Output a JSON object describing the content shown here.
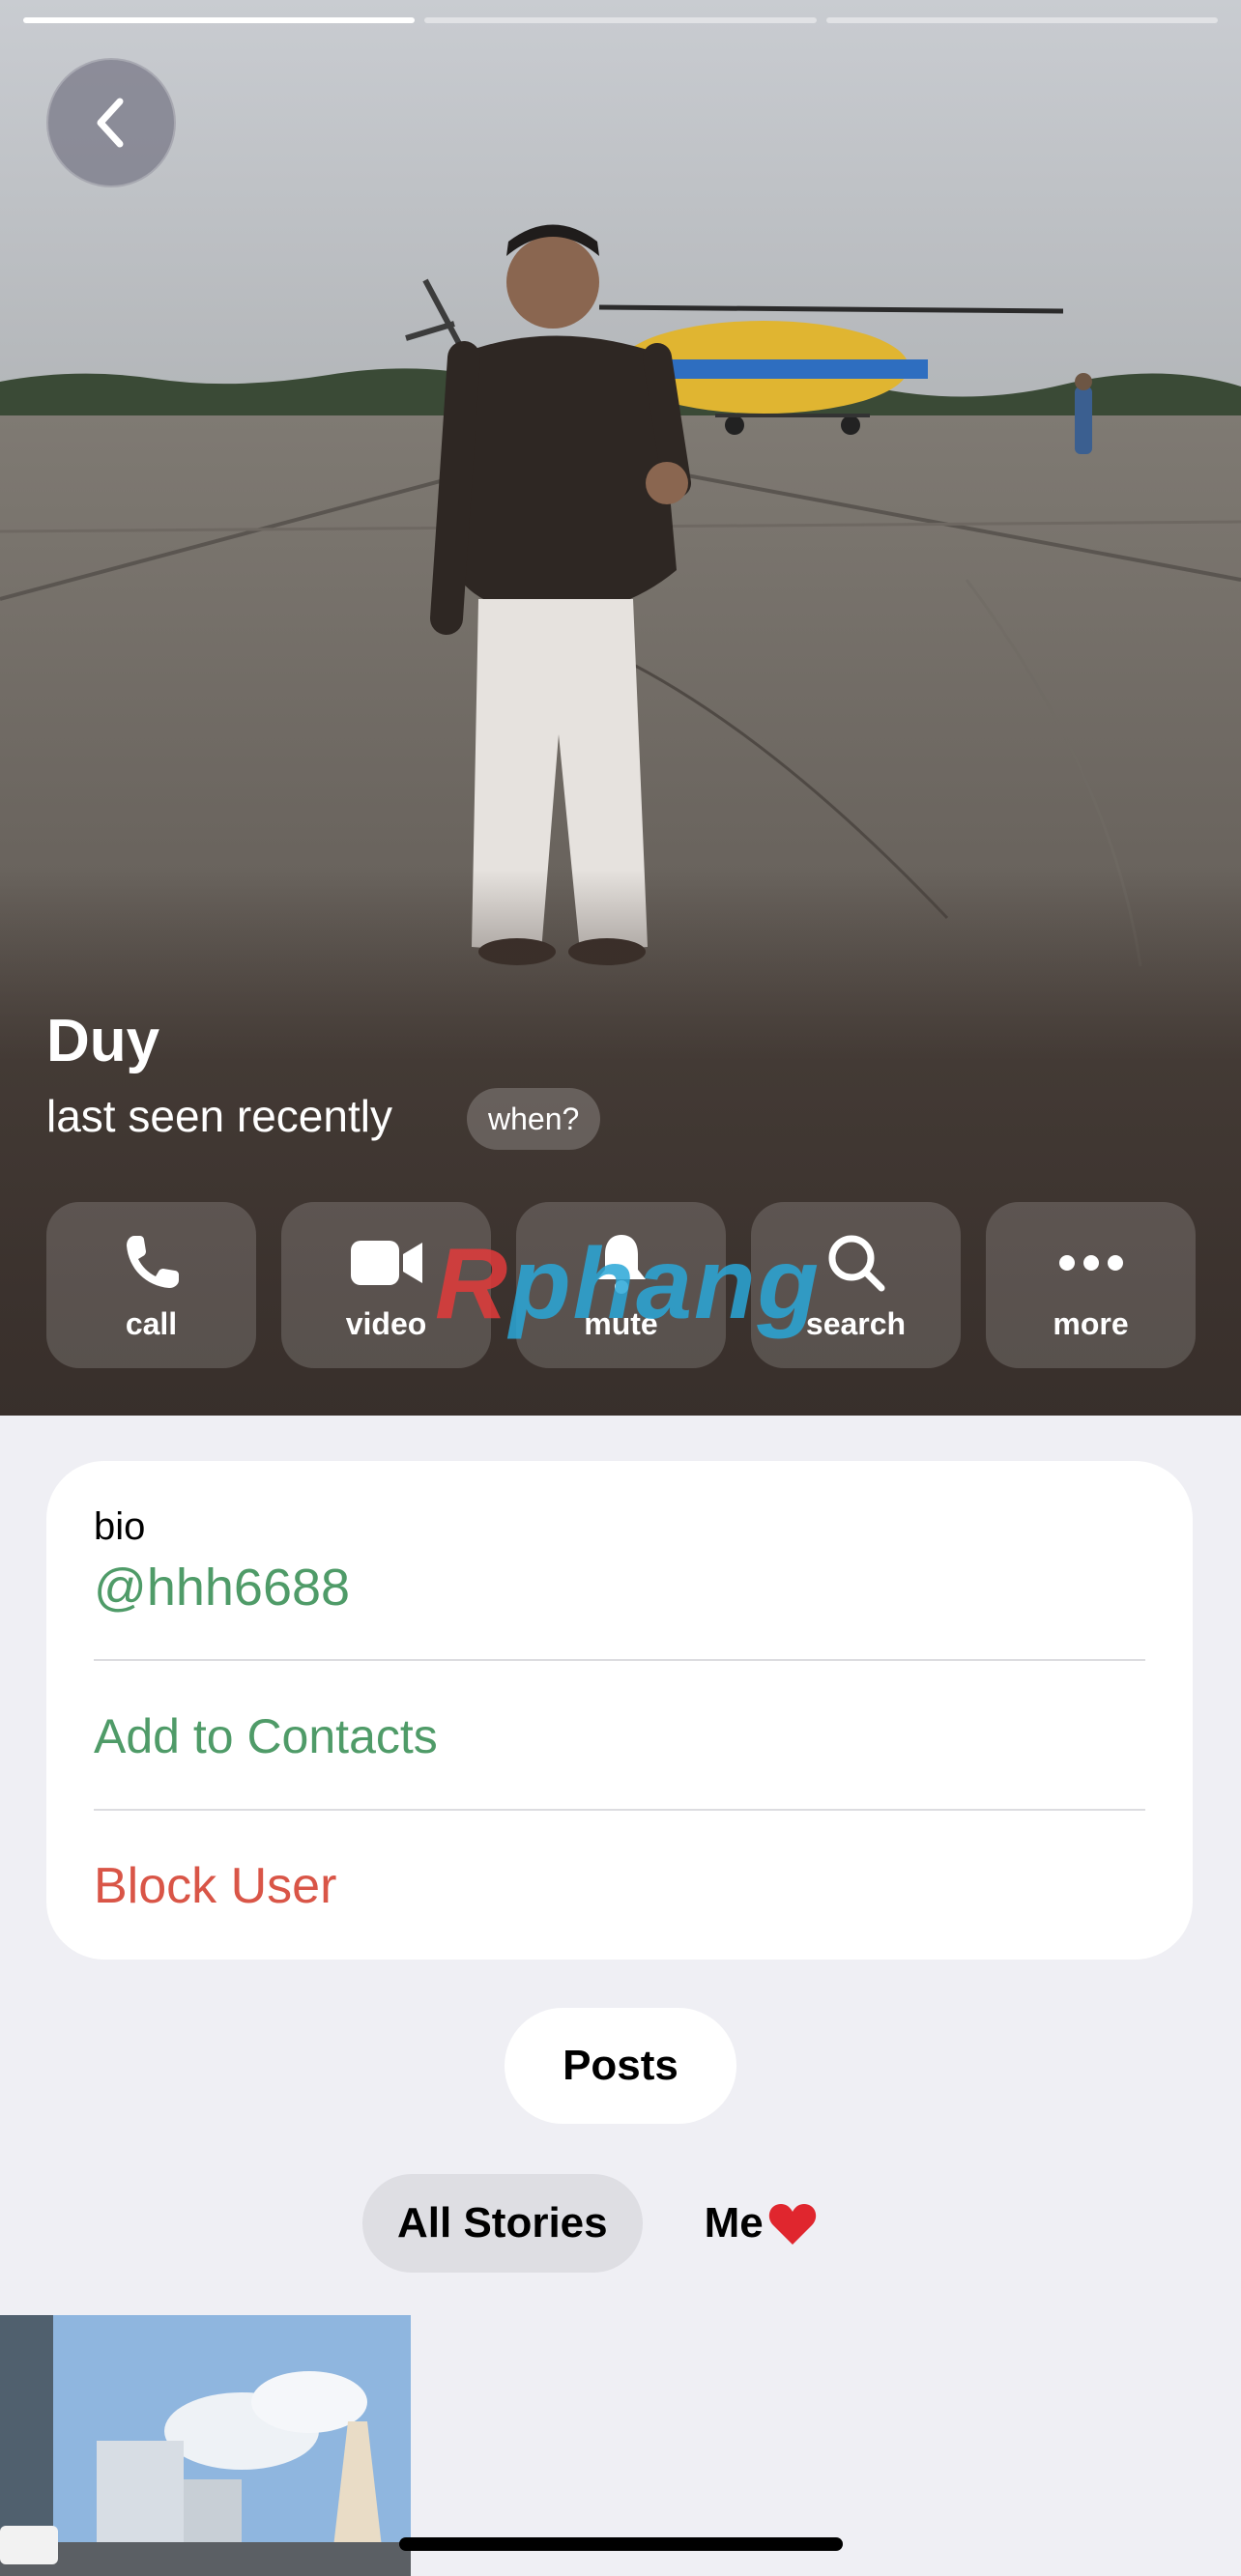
{
  "profile": {
    "name": "Duy",
    "status": "last seen recently",
    "when_label": "when?"
  },
  "story_progress": {
    "segments": 3,
    "active_index": 0
  },
  "actions": [
    {
      "label": "call",
      "icon": "phone-icon"
    },
    {
      "label": "video",
      "icon": "video-camera-icon"
    },
    {
      "label": "mute",
      "icon": "bell-icon"
    },
    {
      "label": "search",
      "icon": "search-icon"
    },
    {
      "label": "more",
      "icon": "ellipsis-icon"
    }
  ],
  "watermark": {
    "part1": "R",
    "part2": "phang"
  },
  "info": {
    "bio_label": "bio",
    "bio_value": "@hhh6688",
    "add_contacts": "Add to Contacts",
    "block_user": "Block User"
  },
  "tabs": {
    "posts": "Posts",
    "stories": [
      {
        "label": "All Stories",
        "active": true
      },
      {
        "label": "Me",
        "emoji": "heart",
        "active": false
      }
    ]
  },
  "colors": {
    "accent_green": "#4f9b68",
    "destructive_red": "#d95547",
    "background": "#efeff4"
  }
}
